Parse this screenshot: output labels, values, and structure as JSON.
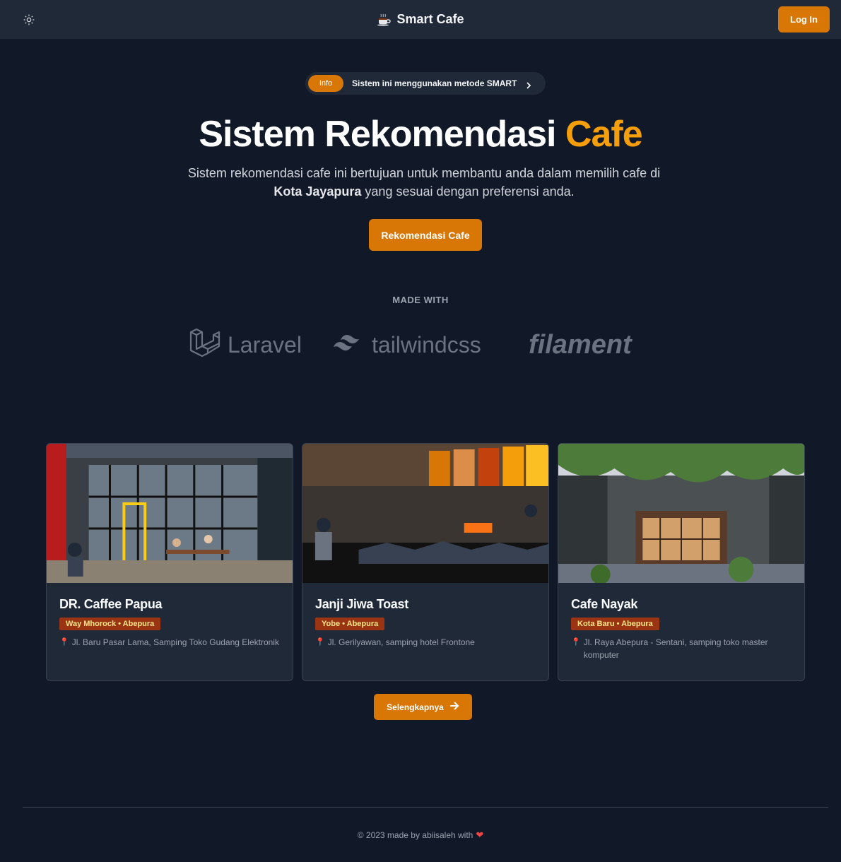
{
  "nav": {
    "brand_icon": "coffee-cup-icon",
    "brand": "Smart Cafe",
    "login_label": "Log In",
    "theme_icon": "sun-icon"
  },
  "hero": {
    "info_badge": "Info",
    "info_text": "Sistem ini menggunakan metode SMART",
    "title_main": "Sistem Rekomendasi",
    "title_accent": "Cafe",
    "desc_part1": "Sistem rekomendasi cafe ini bertujuan untuk membantu anda dalam memilih cafe di",
    "desc_bold": "Kota Jayapura",
    "desc_part2": "yang sesuai dengan preferensi anda.",
    "cta_label": "Rekomendasi Cafe"
  },
  "made_with": {
    "label": "MADE WITH",
    "logos": [
      "Laravel",
      "tailwindcss",
      "filament"
    ]
  },
  "cafes": [
    {
      "name": "DR. Caffee Papua",
      "badge": "Way Mhorock • Abepura",
      "address": "Jl. Baru Pasar Lama, Samping Toko Gudang Elektronik"
    },
    {
      "name": "Janji Jiwa Toast",
      "badge": "Yobe • Abepura",
      "address": "Jl. Gerilyawan, samping hotel Frontone"
    },
    {
      "name": "Cafe Nayak",
      "badge": "Kota Baru • Abepura",
      "address": "Jl. Raya Abepura - Sentani, samping toko master komputer"
    }
  ],
  "more_label": "Selengkapnya",
  "footer": {
    "text": "© 2023 made by abiisaleh with",
    "heart": "❤"
  },
  "colors": {
    "background": "#111827",
    "surface": "#1f2937",
    "accent": "#d97706",
    "accent_text": "#f59e0b"
  }
}
